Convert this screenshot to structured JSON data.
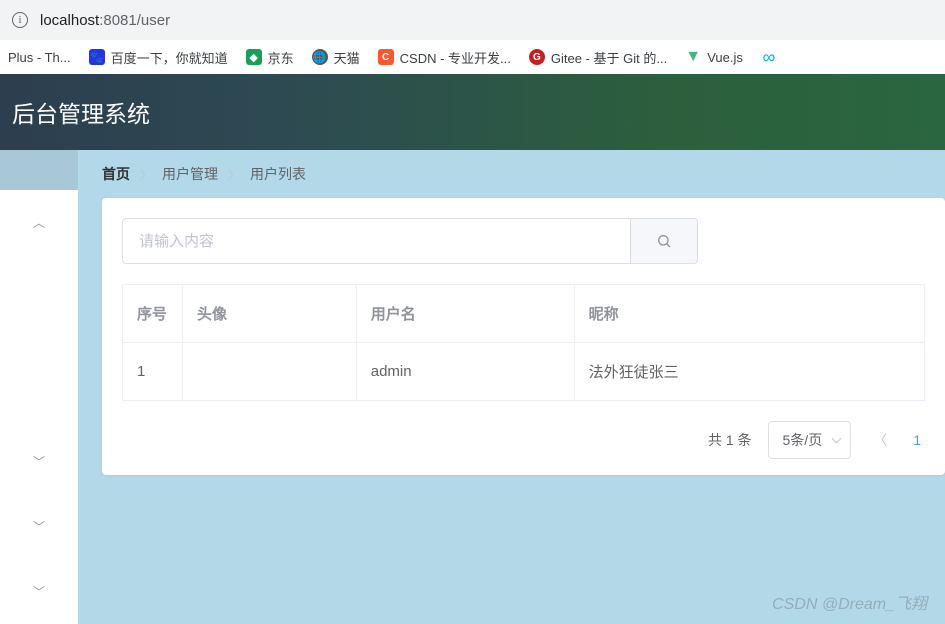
{
  "url": {
    "host": "localhost",
    "path": ":8081/user"
  },
  "bookmarks": [
    {
      "label": "Plus - Th..."
    },
    {
      "label": "百度一下，你就知道"
    },
    {
      "label": "京东"
    },
    {
      "label": "天猫"
    },
    {
      "label": "CSDN - 专业开发..."
    },
    {
      "label": "Gitee - 基于 Git 的..."
    },
    {
      "label": "Vue.js"
    }
  ],
  "header": {
    "title": "后台管理系统"
  },
  "breadcrumb": {
    "home": "首页",
    "mid": "用户管理",
    "last": "用户列表"
  },
  "search": {
    "placeholder": "请输入内容"
  },
  "table": {
    "headers": {
      "index": "序号",
      "avatar": "头像",
      "username": "用户名",
      "nickname": "昵称"
    },
    "rows": [
      {
        "index": "1",
        "avatar": "",
        "username": "admin",
        "nickname": "法外狂徒张三"
      }
    ]
  },
  "pager": {
    "total": "共 1 条",
    "pagesize": "5条/页",
    "page": "1"
  },
  "watermark": "CSDN @Dream_飞翔"
}
